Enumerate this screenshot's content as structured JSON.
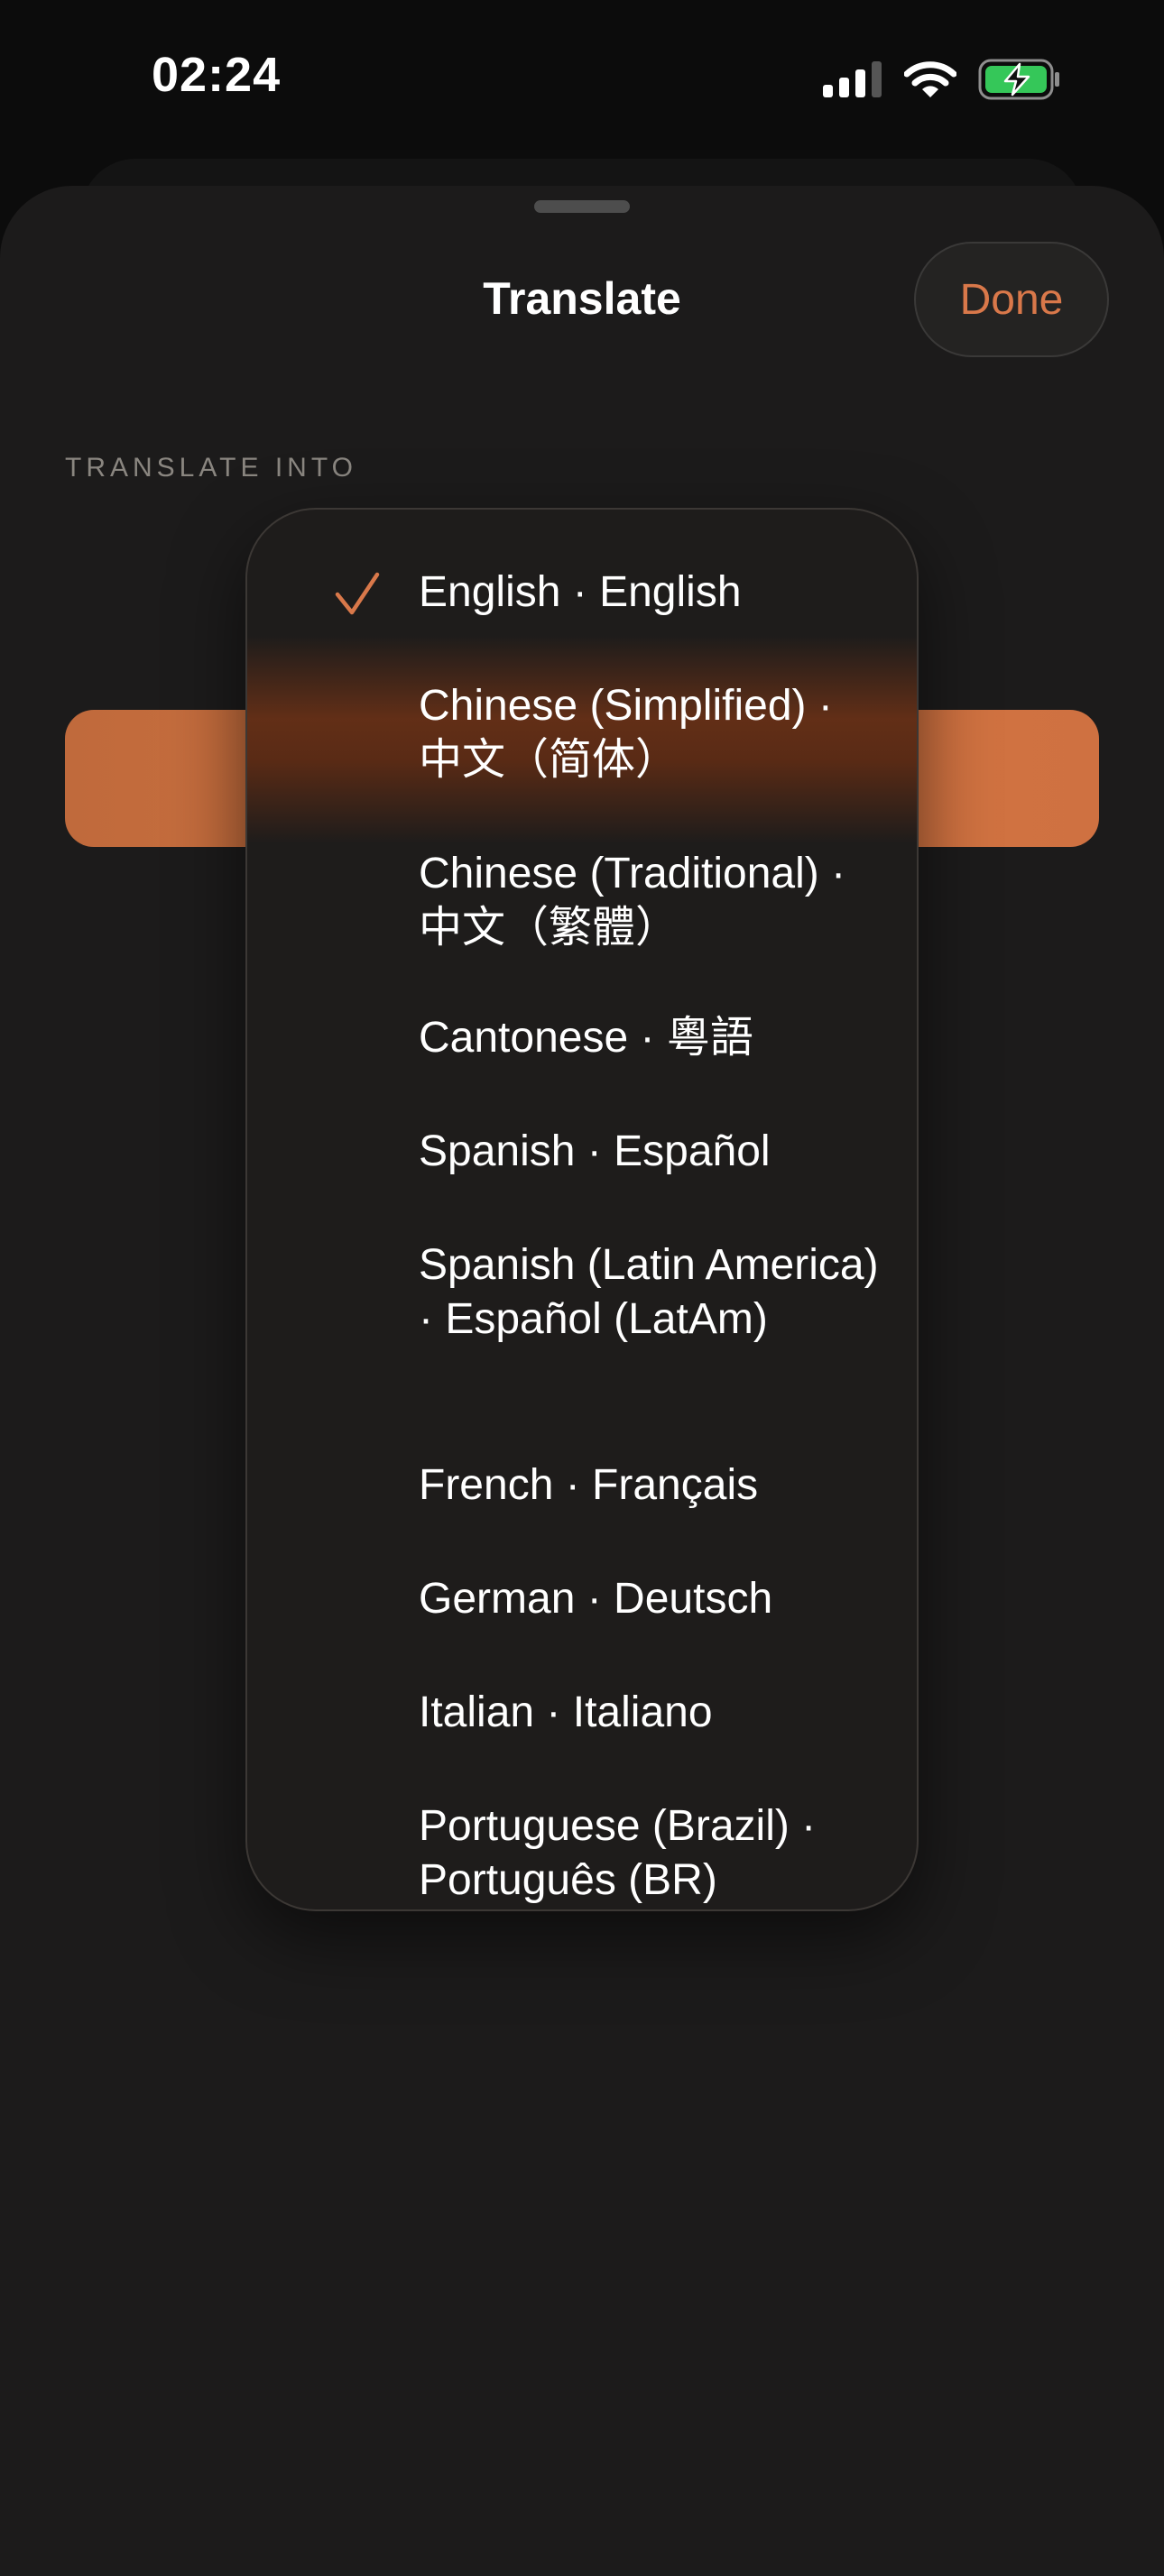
{
  "status_bar": {
    "time": "02:24",
    "icons": [
      "cellular-signal-icon",
      "wifi-icon",
      "battery-charging-icon"
    ],
    "battery_color": "#35c759"
  },
  "sheet": {
    "title": "Translate",
    "done_label": "Done",
    "section_label": "TRANSLATE INTO"
  },
  "colors": {
    "accent": "#d9784a",
    "background": "#1c1b1b"
  },
  "language_menu": {
    "selected": "English · English",
    "items": [
      {
        "label": "English · English",
        "checked": true
      },
      {
        "label": "Chinese (Simplified) · 中文（简体）",
        "checked": false
      },
      {
        "label": "Chinese (Traditional) · 中文（繁體）",
        "checked": false
      },
      {
        "label": "Cantonese · 粵語",
        "checked": false
      },
      {
        "label": "Spanish · Español",
        "checked": false
      },
      {
        "label": "Spanish (Latin America) · Español (LatAm)",
        "checked": false
      },
      {
        "label": "French · Français",
        "checked": false
      },
      {
        "label": "German · Deutsch",
        "checked": false
      },
      {
        "label": "Italian · Italiano",
        "checked": false
      },
      {
        "label": "Portuguese (Brazil) · Português (BR)",
        "checked": false
      }
    ]
  }
}
